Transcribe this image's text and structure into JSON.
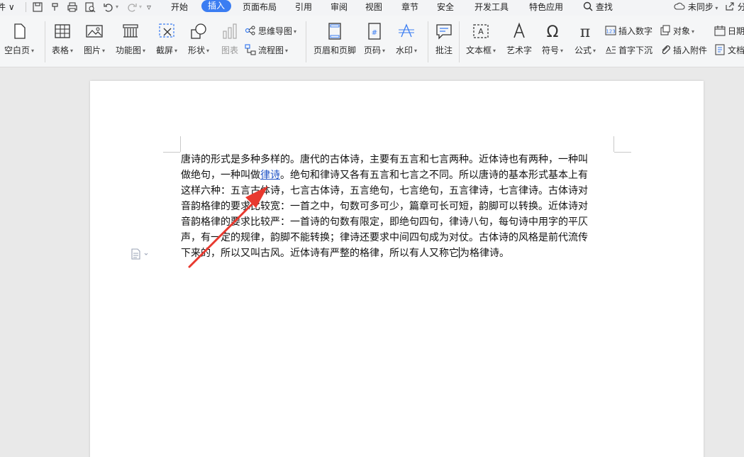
{
  "menubar": {
    "file_label": "件",
    "tabs": [
      "开始",
      "插入",
      "页面布局",
      "引用",
      "审阅",
      "视图",
      "章节",
      "安全",
      "开发工具",
      "特色应用"
    ],
    "active_tab": "插入",
    "search_label": "查找",
    "sync_label": "未同步",
    "share_label": "分"
  },
  "ribbon": {
    "blank_page": "空白页",
    "table": "表格",
    "picture": "图片",
    "function_chart": "功能图",
    "screenshot": "截屏",
    "shape": "形状",
    "chart": "图表",
    "mindmap": "思维导图",
    "flowchart": "流程图",
    "header_footer": "页眉和页脚",
    "page_number": "页码",
    "watermark": "水印",
    "comment": "批注",
    "textbox": "文本框",
    "wordart": "艺术字",
    "symbol": "符号",
    "formula": "公式",
    "insert_number": "插入数字",
    "object": "对象",
    "drop_cap": "首字下沉",
    "attachment": "插入附件",
    "date": "日期",
    "doc": "文档"
  },
  "document": {
    "lines": [
      "唐诗的形式是多种多样的。唐代的古体诗，主要有五言和七言两种。近体诗也有两种，一种叫",
      "这样六种：五言古体诗，七言古体诗，五言绝句，七言绝句，五言律诗，七言律诗。古体诗对",
      "音韵格律的要求比较宽：一首之中，句数可多可少，篇章可长可短，韵脚可以转换。近体诗对",
      "音韵格律的要求比较严：一首诗的句数有限定，即绝句四句，律诗八句，每句诗中用字的平仄",
      "声，有一定的规律，韵脚不能转换；律诗还要求中间四句成为对仗。古体诗的风格是前代流传"
    ],
    "line2_before": "做绝句，一种叫做",
    "line2_link": "律诗",
    "line2_after": "。绝句和律诗又各有五言和七言之不同。所以唐诗的基本形式基本上有",
    "last_before": "下来的，所以又叫古风。近体诗有严整的格律，所以有人又称它",
    "last_after": "为格律诗。"
  },
  "colors": {
    "accent": "#3b7df2",
    "link": "#1a4fc4",
    "arrow": "#e8392f"
  }
}
